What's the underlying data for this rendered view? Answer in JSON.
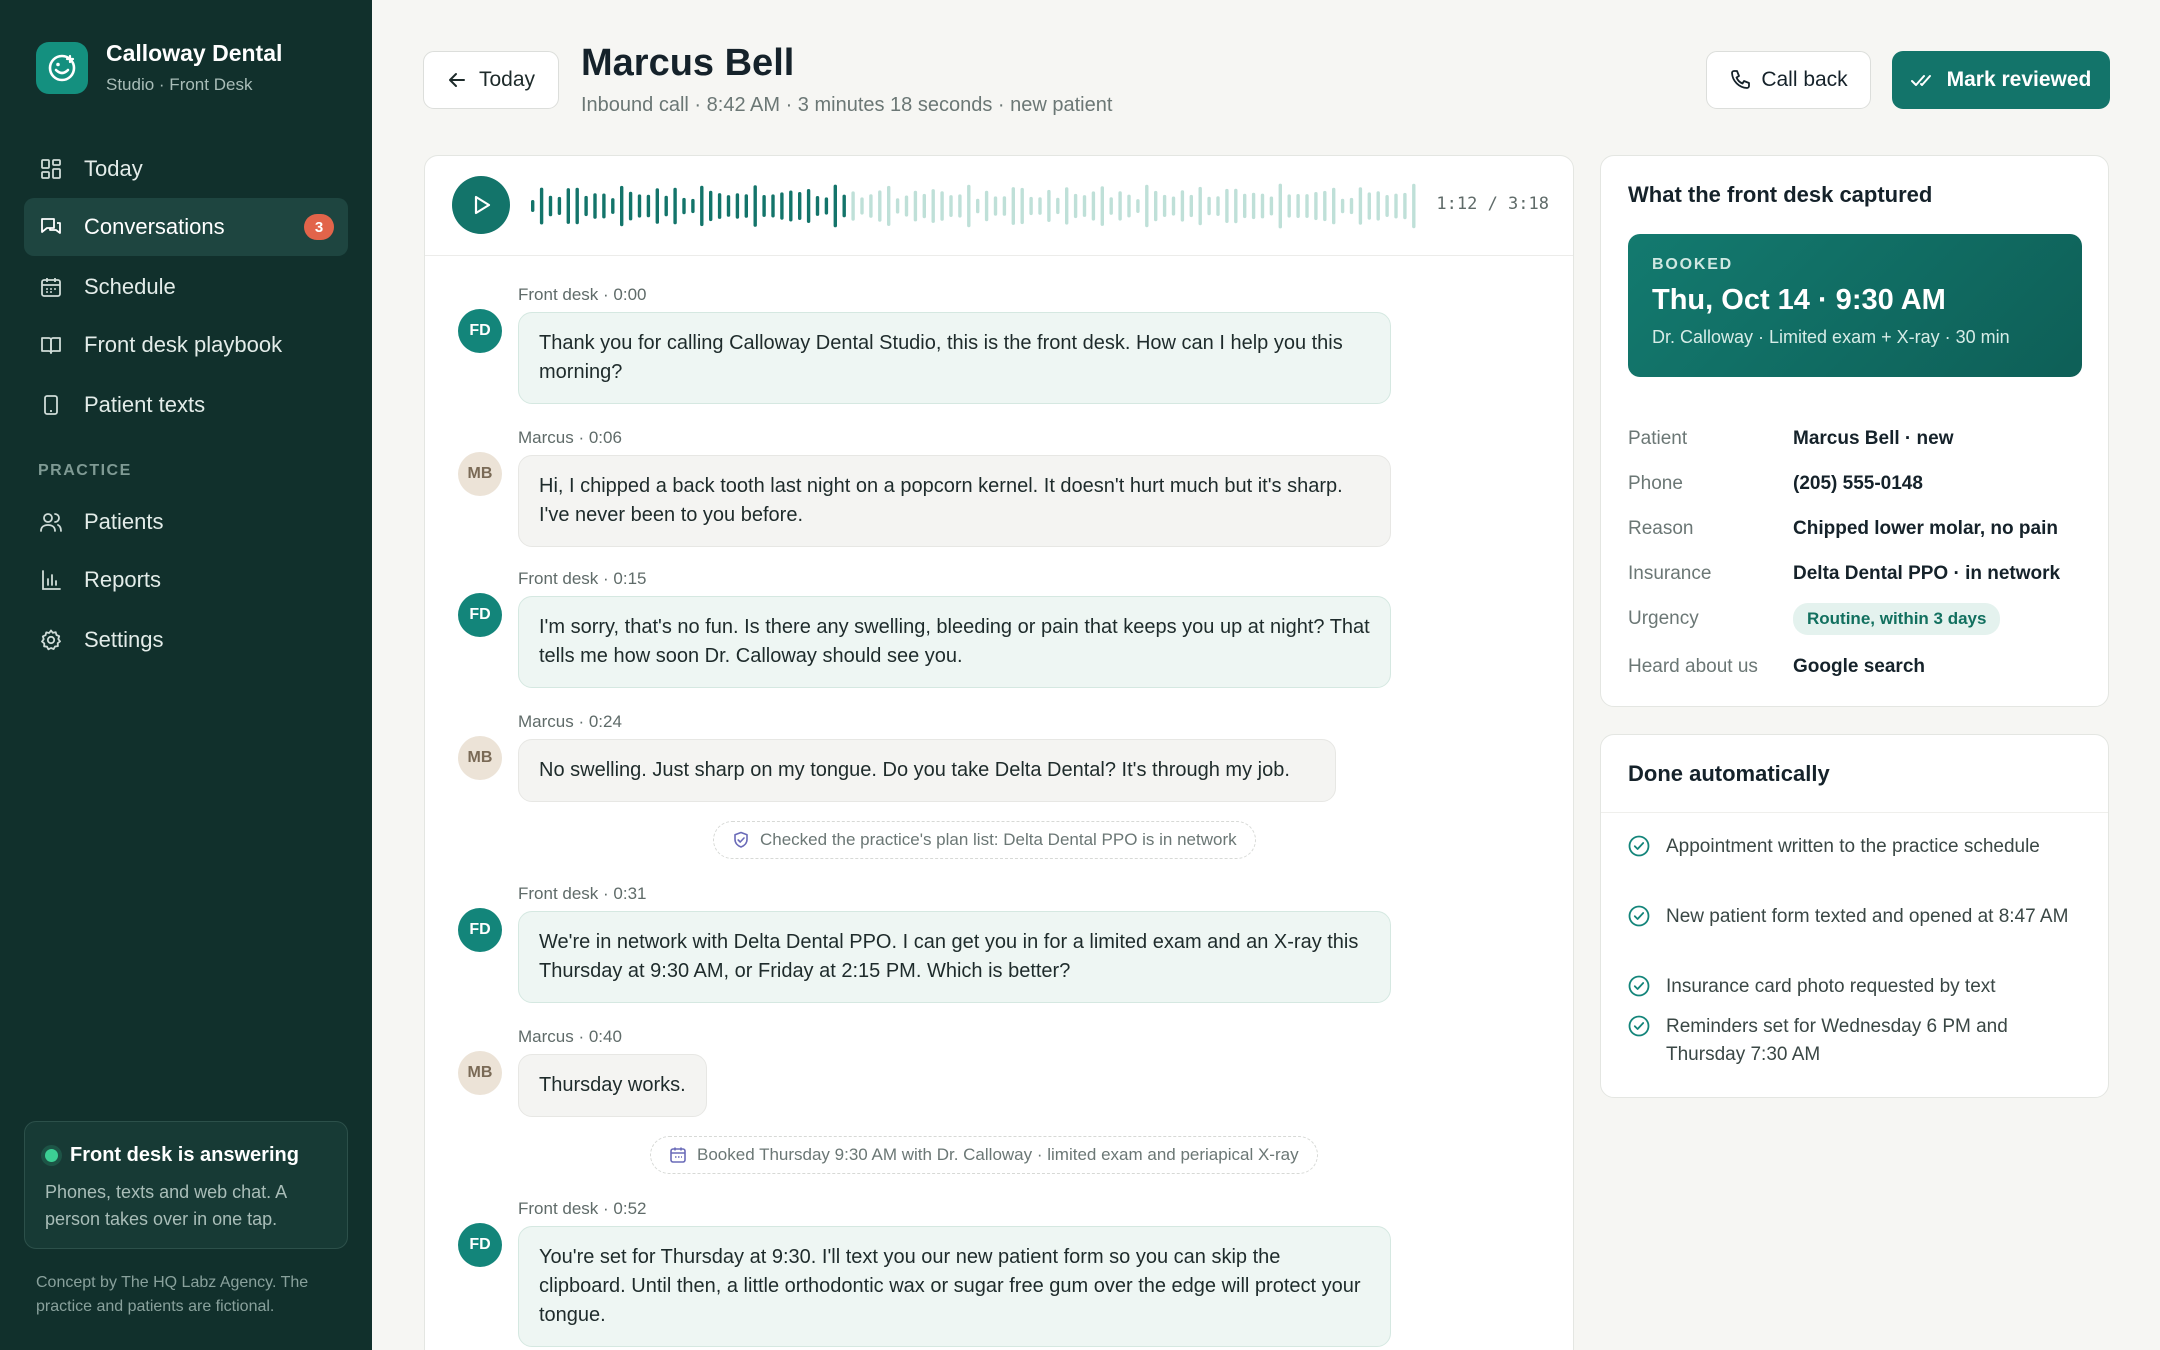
{
  "brand": {
    "name": "Calloway Dental",
    "subtitle": "Studio · Front Desk"
  },
  "nav": {
    "items": [
      {
        "label": "Today",
        "icon": "grid-icon"
      },
      {
        "label": "Conversations",
        "icon": "chat-icon",
        "badge": "3",
        "active": true
      },
      {
        "label": "Schedule",
        "icon": "calendar-icon"
      },
      {
        "label": "Front desk playbook",
        "icon": "book-icon"
      },
      {
        "label": "Patient texts",
        "icon": "phone-icon"
      }
    ],
    "section_label": "PRACTICE",
    "practice_items": [
      {
        "label": "Patients",
        "icon": "users-icon"
      },
      {
        "label": "Reports",
        "icon": "bar-chart-icon"
      },
      {
        "label": "Settings",
        "icon": "gear-icon"
      }
    ]
  },
  "status": {
    "title": "Front desk is answering",
    "text": "Phones, texts and web chat. A person takes over in one tap."
  },
  "credit": "Concept by The HQ Labz Agency. The practice and patients are fictional.",
  "header": {
    "back_label": "Today",
    "title": "Marcus Bell",
    "subtitle": "Inbound call · 8:42 AM · 3 minutes 18 seconds · new patient",
    "call_back_label": "Call back",
    "mark_reviewed_label": "Mark reviewed"
  },
  "player": {
    "time": "1:12 / 3:18",
    "progress": 0.36
  },
  "transcript": [
    {
      "type": "fd",
      "initials": "FD",
      "meta": "Front desk · 0:00",
      "text": "Thank you for calling Calloway Dental Studio, this is the front desk. How can I help you this morning?"
    },
    {
      "type": "mb",
      "initials": "MB",
      "meta": "Marcus · 0:06",
      "text": "Hi, I chipped a back tooth last night on a popcorn kernel. It doesn't hurt much but it's sharp. I've never been to you before."
    },
    {
      "type": "fd",
      "initials": "FD",
      "meta": "Front desk · 0:15",
      "text": "I'm sorry, that's no fun. Is there any swelling, bleeding or pain that keeps you up at night? That tells me how soon Dr. Calloway should see you."
    },
    {
      "type": "mb",
      "initials": "MB",
      "meta": "Marcus · 0:24",
      "text": "No swelling. Just sharp on my tongue. Do you take Delta Dental? It's through my job."
    },
    {
      "type": "event",
      "icon": "shield-icon",
      "text": "Checked the practice's plan list: Delta Dental PPO is in network"
    },
    {
      "type": "fd",
      "initials": "FD",
      "meta": "Front desk · 0:31",
      "text": "We're in network with Delta Dental PPO. I can get you in for a limited exam and an X-ray this Thursday at 9:30 AM, or Friday at 2:15 PM. Which is better?"
    },
    {
      "type": "mb",
      "initials": "MB",
      "meta": "Marcus · 0:40",
      "text": "Thursday works."
    },
    {
      "type": "event",
      "icon": "calendar-icon",
      "text": "Booked Thursday 9:30 AM with Dr. Calloway · limited exam and periapical X-ray"
    },
    {
      "type": "fd",
      "initials": "FD",
      "meta": "Front desk · 0:52",
      "text": "You're set for Thursday at 9:30. I'll text you our new patient form so you can skip the clipboard. Until then, a little orthodontic wax or sugar free gum over the edge will protect your tongue."
    }
  ],
  "captured": {
    "heading": "What the front desk captured",
    "booked_label": "BOOKED",
    "booked_date": "Thu, Oct 14 · 9:30 AM",
    "booked_detail": "Dr. Calloway · Limited exam + X-ray · 30 min",
    "fields": [
      {
        "key": "Patient",
        "value": "Marcus Bell · new"
      },
      {
        "key": "Phone",
        "value": "(205) 555-0148"
      },
      {
        "key": "Reason",
        "value": "Chipped lower molar, no pain"
      },
      {
        "key": "Insurance",
        "value": "Delta Dental PPO · in network"
      },
      {
        "key": "Urgency",
        "value": "Routine, within 3 days",
        "pill": true
      },
      {
        "key": "Heard about us",
        "value": "Google search"
      }
    ]
  },
  "automatic": {
    "heading": "Done automatically",
    "items": [
      "Appointment written to the practice schedule",
      "New patient form texted and opened at 8:47 AM",
      "Insurance card photo requested by text",
      "Reminders set for Wednesday 6 PM and Thursday 7:30 AM"
    ]
  },
  "colors": {
    "accent": "#13746a",
    "sidebar": "#11302c",
    "badge": "#e2644a",
    "status_dot": "#3ccf94"
  }
}
